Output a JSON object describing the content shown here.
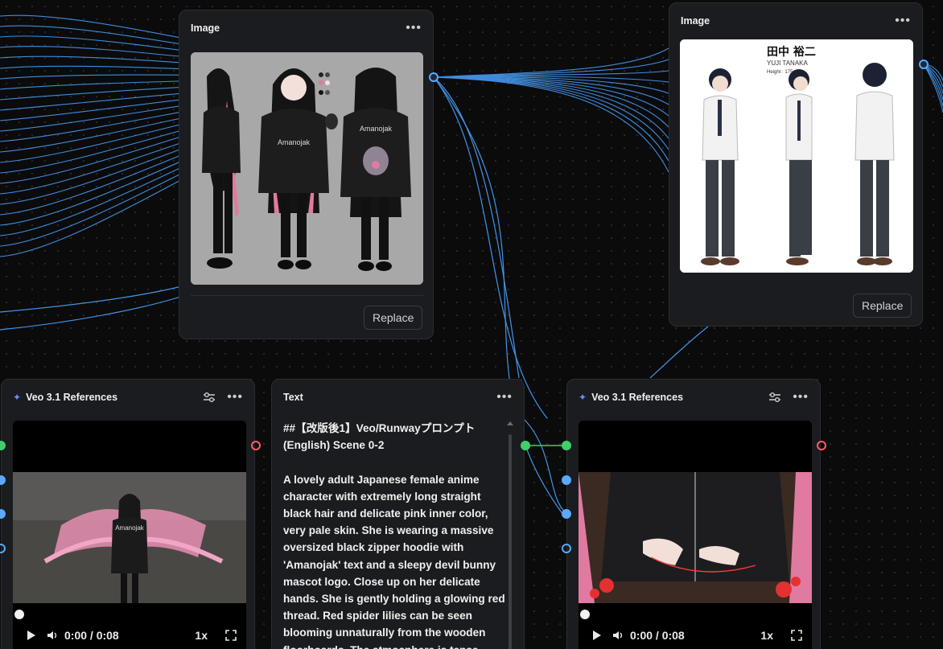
{
  "nodes": {
    "image_left": {
      "title": "Image",
      "replace_label": "Replace"
    },
    "image_right": {
      "title": "Image",
      "replace_label": "Replace",
      "sheet_title": "田中 裕二",
      "sheet_subtitle": "YUJI TANAKA",
      "sheet_height": "Height : 175cm"
    },
    "veo_left": {
      "title": "Veo 3.1 References",
      "time": "0:00 / 0:08",
      "speed": "1x"
    },
    "text": {
      "title": "Text",
      "content": "##【改版後1】Veo/Runwayプロンプト (English) Scene 0-2\n\nA lovely adult Japanese female anime character with extremely long straight black hair and delicate pink inner color, very pale skin. She is wearing a massive oversized black zipper hoodie with 'Amanojak' text and a sleepy devil bunny mascot logo. Close up on her delicate hands. She is gently holding a glowing red thread. Red spider lilies can be seen blooming unnaturally from the wooden floorboards. The atmosphere is tense"
    },
    "veo_right": {
      "title": "Veo 3.1 References",
      "time": "0:00 / 0:08",
      "speed": "1x"
    }
  },
  "colors": {
    "wire_blue": "#5aa9ff",
    "wire_green": "#3ecf6b",
    "port_red": "#ff5a6b",
    "node_bg": "#1b1c1f"
  },
  "icons": [
    "more-dots-icon",
    "sliders-icon",
    "sparkle-icon",
    "play-icon",
    "volume-icon",
    "fullscreen-icon"
  ]
}
